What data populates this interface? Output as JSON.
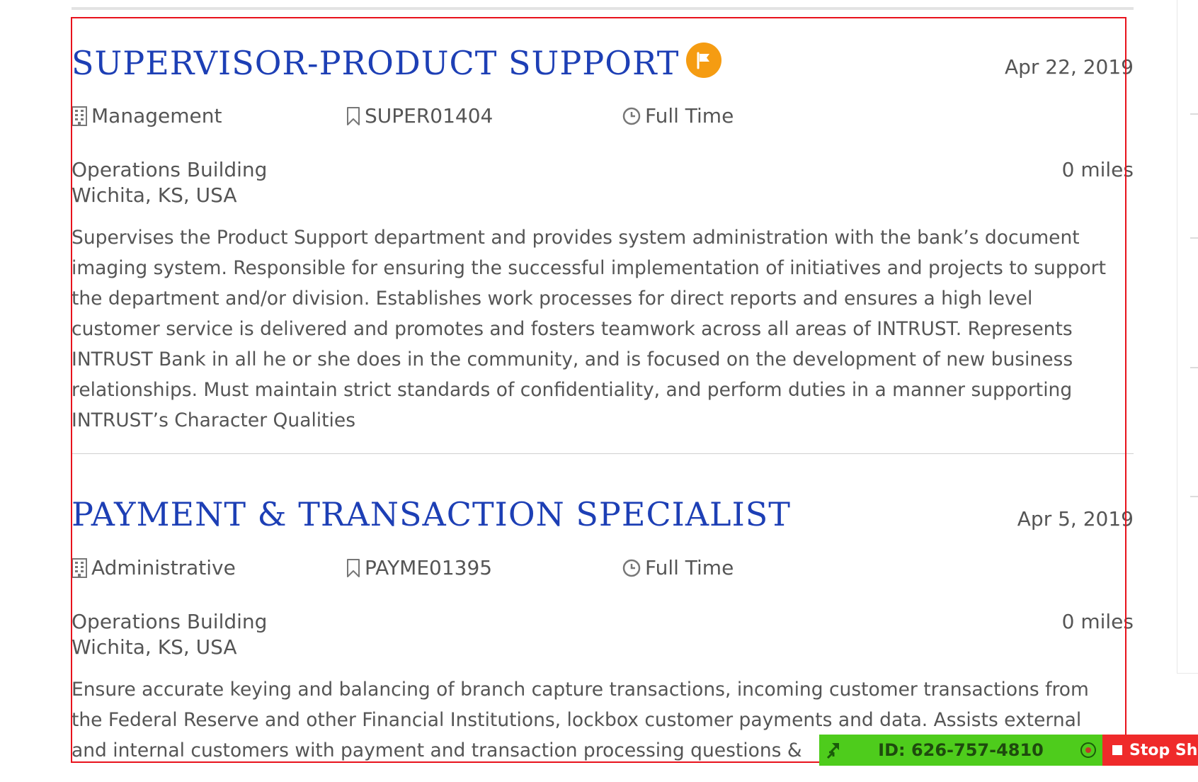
{
  "jobs": [
    {
      "title": "SUPERVISOR-PRODUCT SUPPORT",
      "flag_icon": "flag-icon",
      "date": "Apr 22, 2019",
      "category": "Management",
      "requisition_id": "SUPER01404",
      "employment_type": "Full Time",
      "location_line1": "Operations Building",
      "location_line2": "Wichita, KS, USA",
      "distance": "0 miles",
      "description_lines": [
        "Supervises the Product Support department and provides system administration with the bank’s document",
        "imaging system. Responsible for ensuring the successful implementation of initiatives and projects to support",
        "the department and/or division. Establishes work processes for direct reports and ensures a high level",
        "customer service is delivered and promotes and fosters teamwork across all areas of INTRUST. Represents",
        "INTRUST Bank in all he or she does in the community, and is focused on the development of new business",
        "relationships. Must maintain strict standards of confidentiality, and perform duties in a manner supporting",
        "INTRUST’s Character Qualities"
      ]
    },
    {
      "title": "PAYMENT & TRANSACTION SPECIALIST",
      "date": "Apr 5, 2019",
      "category": "Administrative",
      "requisition_id": "PAYME01395",
      "employment_type": "Full Time",
      "location_line1": "Operations Building",
      "location_line2": "Wichita, KS, USA",
      "distance": "0 miles",
      "description_lines": [
        "Ensure accurate keying and balancing of branch capture transactions, incoming customer transactions from",
        "the Federal Reserve and other Financial Institutions, lockbox customer payments and data. Assists external",
        "and internal customers with payment and transaction processing questions &"
      ]
    }
  ],
  "teamviewer": {
    "session_id": "ID: 626-757-4810",
    "stop_label": "Stop Sha"
  },
  "colors": {
    "title": "#1d3fb5",
    "body_text": "#555555",
    "flag_badge": "#f59c12",
    "highlight_border": "#e8121c",
    "teamviewer_green": "#4ecc1c",
    "stop_red": "#ef2a2a"
  }
}
